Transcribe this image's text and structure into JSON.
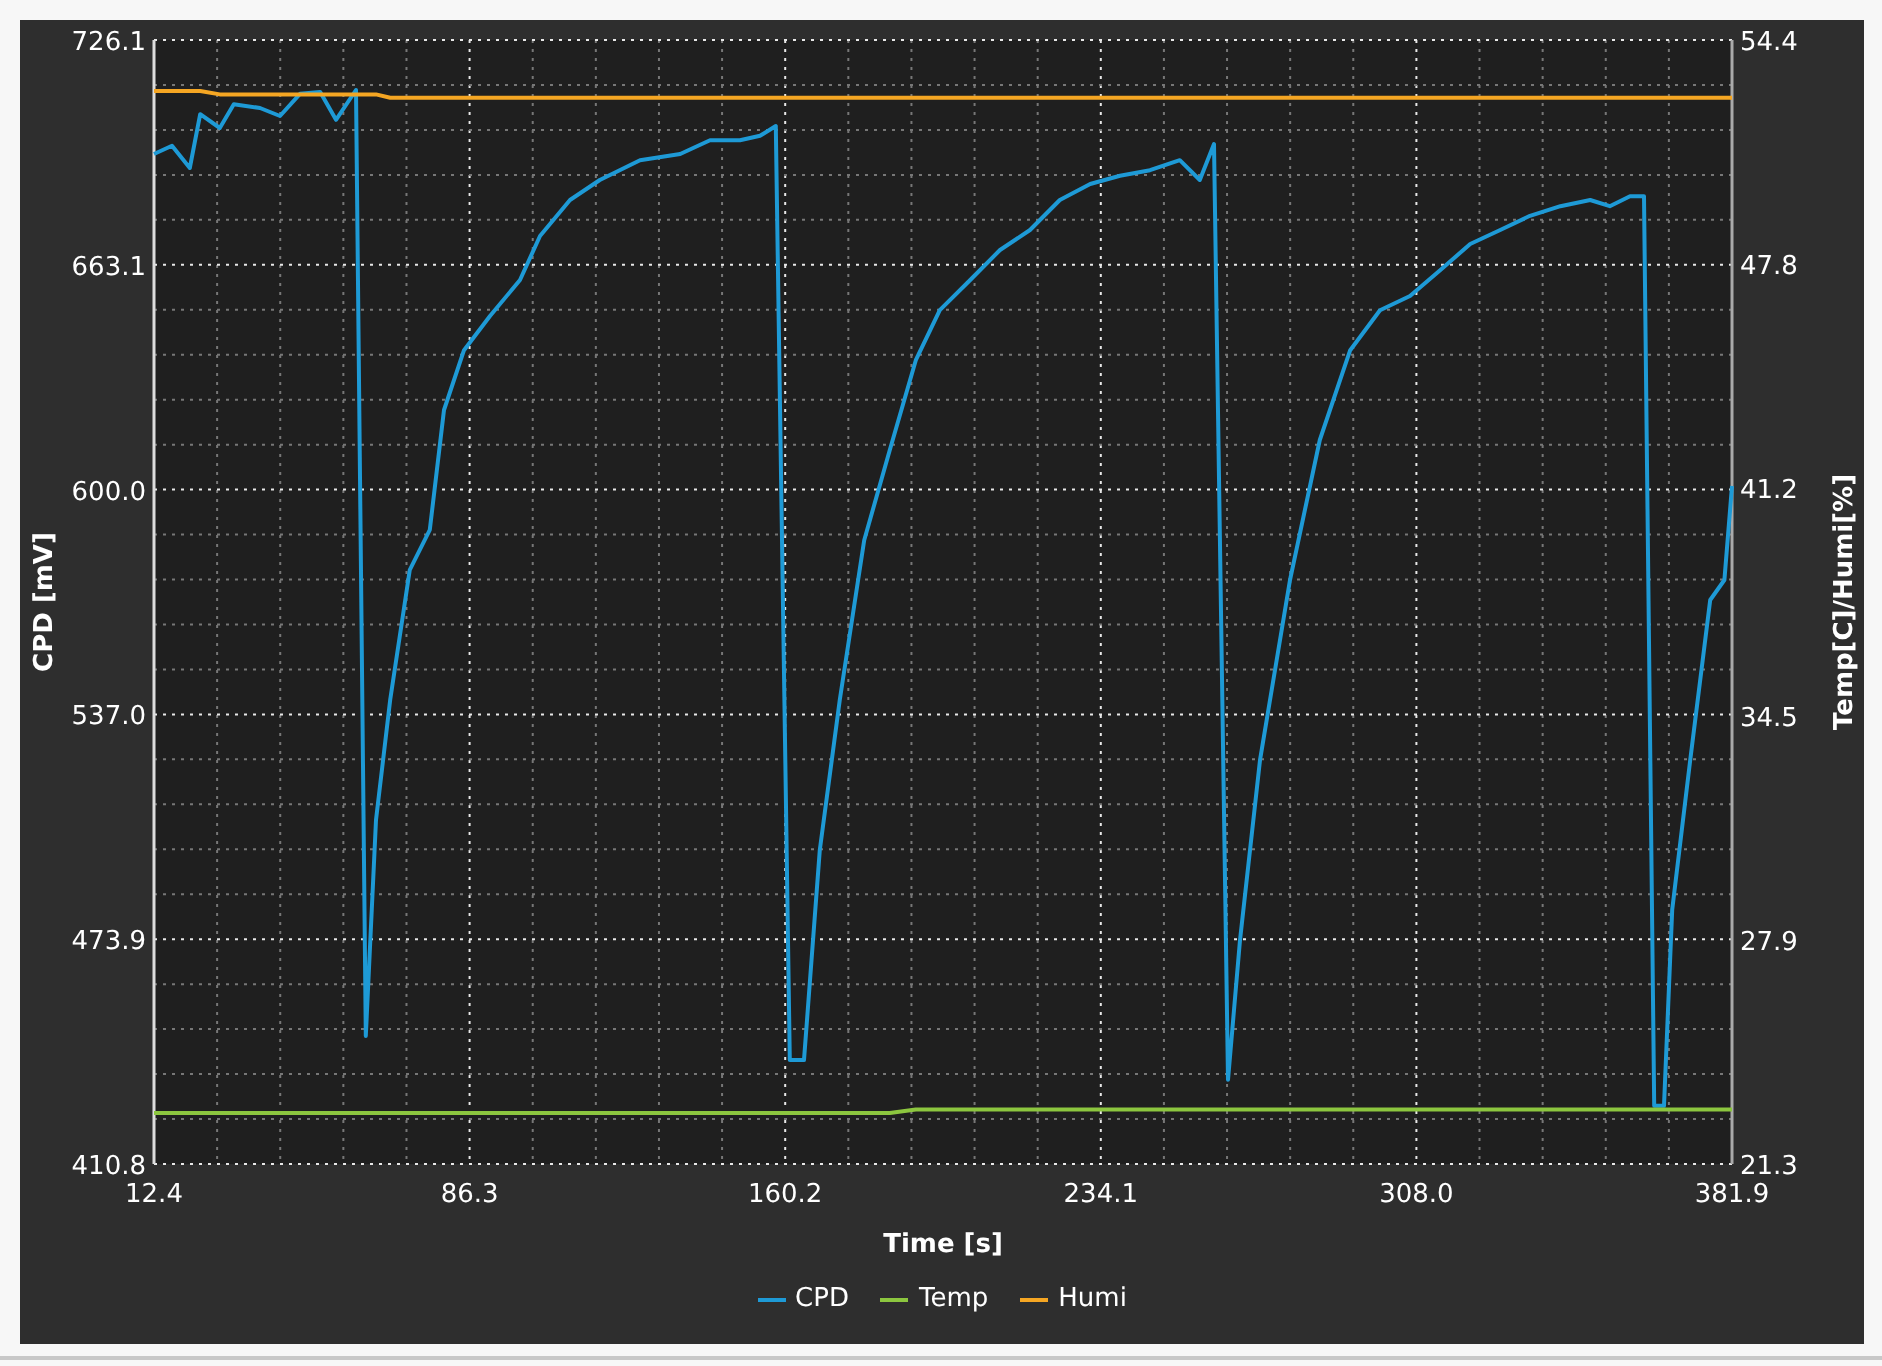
{
  "chart_data": {
    "type": "line",
    "grid": true,
    "xlabel": "Time [s]",
    "ylabel": "CPD [mV]",
    "y2label": "Temp[C]/Humi[%]",
    "x": [
      12.4,
      16.6,
      20.8,
      23.2,
      27.8,
      31.1,
      37.2,
      41.9,
      46.6,
      51.3,
      55.0,
      59.7,
      62.0,
      64.4,
      67.7,
      72.3,
      77.0,
      80.3,
      85.0,
      91.1,
      98.1,
      102.8,
      109.8,
      116.8,
      126.2,
      135.6,
      142.6,
      149.6,
      154.3,
      158.0,
      161.3,
      164.6,
      168.3,
      173.0,
      178.7,
      184.7,
      190.8,
      196.4,
      203.5,
      210.5,
      217.5,
      224.5,
      231.6,
      238.6,
      245.6,
      252.6,
      257.3,
      260.6,
      263.9,
      266.7,
      271.4,
      278.4,
      285.4,
      292.5,
      299.5,
      306.5,
      313.6,
      320.6,
      327.6,
      334.6,
      341.7,
      348.7,
      353.3,
      358.0,
      361.3,
      363.7,
      366.0,
      367.9,
      372.1,
      376.8,
      380.1,
      381.9
    ],
    "series": [
      {
        "name": "CPD",
        "color": "#1e9ad6",
        "values": [
          694.1,
          696.4,
          690.2,
          705.3,
          701.4,
          708.1,
          707.0,
          704.8,
          711.0,
          711.5,
          703.7,
          712.1,
          446.7,
          507.3,
          541.0,
          577.5,
          588.7,
          622.3,
          639.1,
          648.7,
          658.8,
          671.1,
          681.2,
          686.8,
          692.4,
          694.1,
          698.0,
          698.0,
          699.2,
          702.0,
          440.0,
          440.0,
          498.9,
          541.0,
          585.8,
          611.1,
          636.3,
          650.3,
          658.8,
          667.2,
          672.8,
          681.2,
          685.7,
          688.0,
          689.6,
          692.4,
          686.8,
          696.9,
          434.4,
          473.6,
          524.1,
          574.6,
          613.9,
          639.1,
          650.3,
          654.3,
          661.6,
          668.9,
          672.8,
          676.8,
          679.5,
          681.2,
          679.5,
          682.3,
          682.3,
          427.1,
          427.1,
          482.1,
          524.1,
          569.0,
          574.6,
          601.0
        ]
      },
      {
        "name": "Temp",
        "color": "#8cc63f",
        "axis": "y2",
        "values": [
          22.8,
          22.8,
          22.8,
          22.8,
          22.8,
          22.8,
          22.8,
          22.8,
          22.8,
          22.8,
          22.8,
          22.8,
          22.8,
          22.8,
          22.8,
          22.8,
          22.8,
          22.8,
          22.8,
          22.8,
          22.8,
          22.8,
          22.8,
          22.8,
          22.8,
          22.8,
          22.8,
          22.8,
          22.8,
          22.8,
          22.8,
          22.8,
          22.8,
          22.8,
          22.8,
          22.8,
          22.9,
          22.9,
          22.9,
          22.9,
          22.9,
          22.9,
          22.9,
          22.9,
          22.9,
          22.9,
          22.9,
          22.9,
          22.9,
          22.9,
          22.9,
          22.9,
          22.9,
          22.9,
          22.9,
          22.9,
          22.9,
          22.9,
          22.9,
          22.9,
          22.9,
          22.9,
          22.9,
          22.9,
          22.9,
          22.9,
          22.9,
          22.9,
          22.9,
          22.9,
          22.9,
          22.9
        ]
      },
      {
        "name": "Humi",
        "color": "#f5a623",
        "axis": "y2",
        "values": [
          52.9,
          52.9,
          52.9,
          52.9,
          52.8,
          52.8,
          52.8,
          52.8,
          52.8,
          52.8,
          52.8,
          52.8,
          52.8,
          52.8,
          52.7,
          52.7,
          52.7,
          52.7,
          52.7,
          52.7,
          52.7,
          52.7,
          52.7,
          52.7,
          52.7,
          52.7,
          52.7,
          52.7,
          52.7,
          52.7,
          52.7,
          52.7,
          52.7,
          52.7,
          52.7,
          52.7,
          52.7,
          52.7,
          52.7,
          52.7,
          52.7,
          52.7,
          52.7,
          52.7,
          52.7,
          52.7,
          52.7,
          52.7,
          52.7,
          52.7,
          52.7,
          52.7,
          52.7,
          52.7,
          52.7,
          52.7,
          52.7,
          52.7,
          52.7,
          52.7,
          52.7,
          52.7,
          52.7,
          52.7,
          52.7,
          52.7,
          52.7,
          52.7,
          52.7,
          52.7,
          52.7,
          52.7
        ]
      }
    ],
    "xlim": [
      12.4,
      381.9
    ],
    "ylim": [
      410.8,
      726.1
    ],
    "y2lim": [
      21.3,
      54.4
    ],
    "xticks": [
      {
        "value": 12.4,
        "label": "12.4"
      },
      {
        "value": 86.3,
        "label": "86.3"
      },
      {
        "value": 160.2,
        "label": "160.2"
      },
      {
        "value": 234.1,
        "label": "234.1"
      },
      {
        "value": 308.0,
        "label": "308.0"
      },
      {
        "value": 381.9,
        "label": "381.9"
      }
    ],
    "yticks": [
      {
        "value": 410.8,
        "label": "410.8"
      },
      {
        "value": 473.9,
        "label": "473.9"
      },
      {
        "value": 537.0,
        "label": "537.0"
      },
      {
        "value": 600.0,
        "label": "600.0"
      },
      {
        "value": 663.1,
        "label": "663.1"
      },
      {
        "value": 726.1,
        "label": "726.1"
      }
    ],
    "y2ticks": [
      {
        "value": 21.3,
        "label": "21.3"
      },
      {
        "value": 27.9,
        "label": "27.9"
      },
      {
        "value": 34.5,
        "label": "34.5"
      },
      {
        "value": 41.2,
        "label": "41.2"
      },
      {
        "value": 47.8,
        "label": "47.8"
      },
      {
        "value": 54.4,
        "label": "54.4"
      }
    ]
  }
}
